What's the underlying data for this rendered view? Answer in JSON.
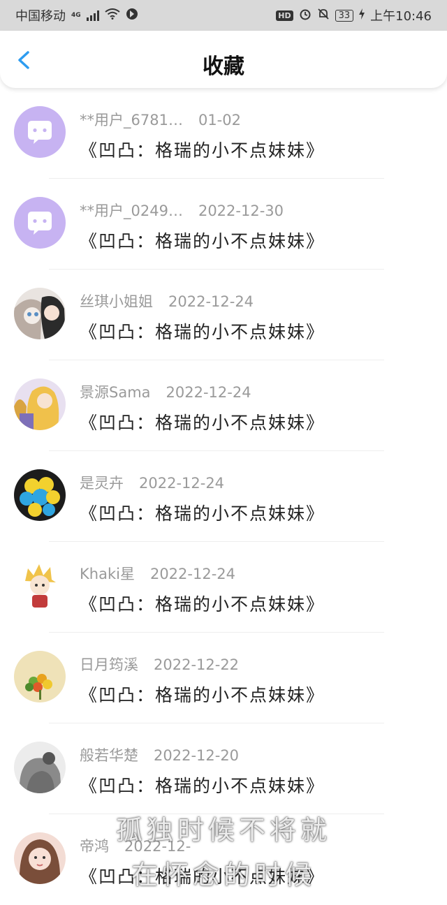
{
  "status_bar": {
    "carrier": "中国移动",
    "network": "4G",
    "battery": "33",
    "time": "上午10:46"
  },
  "header": {
    "title": "收藏"
  },
  "items": [
    {
      "user": "**用户_6781…",
      "date": "01-02",
      "content": "《凹凸：格瑞的小不点妹妹》"
    },
    {
      "user": "**用户_0249…",
      "date": "2022-12-30",
      "content": "《凹凸：格瑞的小不点妹妹》"
    },
    {
      "user": "丝琪小姐姐",
      "date": "2022-12-24",
      "content": "《凹凸：格瑞的小不点妹妹》"
    },
    {
      "user": "景源Sama",
      "date": "2022-12-24",
      "content": "《凹凸：格瑞的小不点妹妹》"
    },
    {
      "user": "是灵卉",
      "date": "2022-12-24",
      "content": "《凹凸：格瑞的小不点妹妹》"
    },
    {
      "user": "Khaki星",
      "date": "2022-12-24",
      "content": "《凹凸：格瑞的小不点妹妹》"
    },
    {
      "user": "日月筠溪",
      "date": "2022-12-22",
      "content": "《凹凸：格瑞的小不点妹妹》"
    },
    {
      "user": "般若华楚",
      "date": "2022-12-20",
      "content": "《凹凸：格瑞的小不点妹妹》"
    },
    {
      "user": "帝鸿",
      "date": "2022-12-",
      "content": "《凹凸：格瑞的小不点妹妹》"
    }
  ],
  "overlay_text": {
    "line1": "孤独时候不将就",
    "line2": "在怀念的时候"
  },
  "colors": {
    "status_bar_bg": "#d9d9d9",
    "back_arrow": "#2d9cf0",
    "default_avatar": "#c7b3f2"
  }
}
